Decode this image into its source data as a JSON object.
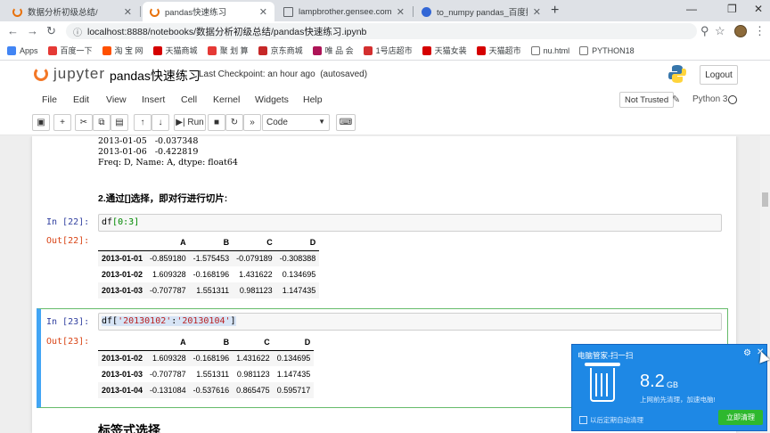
{
  "browser": {
    "tabs": [
      {
        "title": "数据分析初级总结/",
        "color": "#e8710a"
      },
      {
        "title": "pandas快速练习",
        "color": "#e8710a"
      },
      {
        "title": "lampbrother.gensee.com/trai",
        "color": "#5f6368"
      },
      {
        "title": "to_numpy pandas_百度搜索",
        "color": "#3367d6"
      }
    ],
    "url": "localhost:8888/notebooks/数据分析初级总结/pandas快速练习.ipynb",
    "bookmarks": [
      {
        "label": "Apps",
        "color": "#4285f4"
      },
      {
        "label": "百度一下",
        "color": "#e53935"
      },
      {
        "label": "淘 宝 网",
        "color": "#ff5000"
      },
      {
        "label": "天猫商城",
        "color": "#d50000"
      },
      {
        "label": "聚 划 算",
        "color": "#e53935"
      },
      {
        "label": "京东商城",
        "color": "#c62828"
      },
      {
        "label": "唯 品 会",
        "color": "#ad1457"
      },
      {
        "label": "1号店超市",
        "color": "#d32f2f"
      },
      {
        "label": "天猫女装",
        "color": "#d50000"
      },
      {
        "label": "天猫超市",
        "color": "#d50000"
      },
      {
        "label": "nu.html",
        "color": "#757575"
      },
      {
        "label": "PYTHON18",
        "color": "#757575"
      }
    ]
  },
  "jupyter": {
    "logo_text": "jupyter",
    "notebook_name": "pandas快速练习",
    "checkpoint": "Last Checkpoint: an hour ago",
    "autosave": "(autosaved)",
    "logout_label": "Logout",
    "menus": [
      "File",
      "Edit",
      "View",
      "Insert",
      "Cell",
      "Kernel",
      "Widgets",
      "Help"
    ],
    "trust_label": "Not Trusted",
    "kernel_name": "Python 3",
    "run_label": "Run",
    "cell_type": "Code"
  },
  "notebook": {
    "prev_output_lines": [
      "2013-01-05   -0.037348",
      "2013-01-06   -0.422819",
      "Freq: D, Name: A, dtype: float64"
    ],
    "markdown_1": "2.通过[]选择，即对行进行切片:",
    "cell_22": {
      "in_prompt": "In  [22]:",
      "out_prompt": "Out[22]:",
      "code_var": "df",
      "code_slice": "[0:3]",
      "columns": [
        "",
        "A",
        "B",
        "C",
        "D"
      ],
      "rows": [
        [
          "2013-01-01",
          "-0.859180",
          "-1.575453",
          "-0.079189",
          "-0.308388"
        ],
        [
          "2013-01-02",
          "1.609328",
          "-0.168196",
          "1.431622",
          "0.134695"
        ],
        [
          "2013-01-03",
          "-0.707787",
          "1.551311",
          "0.981123",
          "1.147435"
        ]
      ]
    },
    "cell_23": {
      "in_prompt": "In  [23]:",
      "out_prompt": "Out[23]:",
      "code_var": "df[",
      "code_str1": "'20130102'",
      "code_colon": ":",
      "code_str2": "'20130104'",
      "code_end": "]",
      "columns": [
        "",
        "A",
        "B",
        "C",
        "D"
      ],
      "rows": [
        [
          "2013-01-02",
          "1.609328",
          "-0.168196",
          "1.431622",
          "0.134695"
        ],
        [
          "2013-01-03",
          "-0.707787",
          "1.551311",
          "0.981123",
          "1.147435"
        ],
        [
          "2013-01-04",
          "-0.131084",
          "-0.537616",
          "0.865475",
          "0.595717"
        ]
      ]
    },
    "next_heading": "标签式选择"
  },
  "popup": {
    "title": "电脑管家-扫一扫",
    "size_value": "8.2",
    "size_unit": "GB",
    "subtitle": "上网前先清理，加速电脑!",
    "checkbox_label": "以后定期自动清理",
    "button_label": "立即清理"
  }
}
